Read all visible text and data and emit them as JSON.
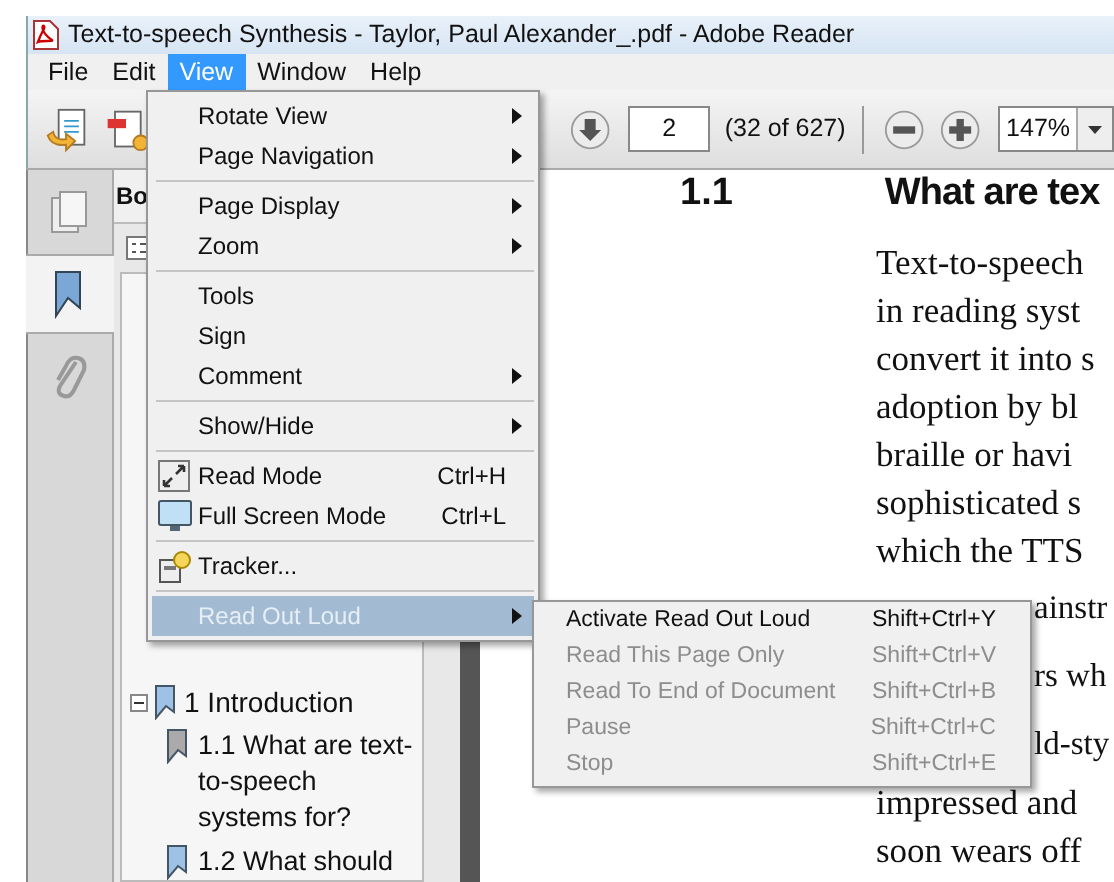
{
  "window": {
    "title": "Text-to-speech Synthesis - Taylor, Paul Alexander_.pdf - Adobe Reader"
  },
  "menu_bar": [
    {
      "label": "File",
      "selected": false
    },
    {
      "label": "Edit",
      "selected": false
    },
    {
      "label": "View",
      "selected": true
    },
    {
      "label": "Window",
      "selected": false
    },
    {
      "label": "Help",
      "selected": false
    }
  ],
  "toolbar": {
    "page_field": {
      "value": "2"
    },
    "page_count": "(32 of 627)",
    "zoom_field": {
      "value": "147%"
    }
  },
  "bookmarks": {
    "header": "Bo",
    "items": [
      {
        "label": "1 Introduction",
        "expanded": true,
        "children": [
          {
            "label": "1.1 What are text-to-speech systems for?"
          },
          {
            "label": "1.2 What should"
          }
        ]
      }
    ]
  },
  "document": {
    "section_number": "1.1",
    "heading": "What are tex",
    "lines": [
      {
        "text": "Text-to-speech",
        "covered": false
      },
      {
        "text": "in reading syst",
        "covered": false
      },
      {
        "text": "convert it into s",
        "covered": false
      },
      {
        "text": "adoption by bl",
        "covered": false
      },
      {
        "text": "braille or havi",
        "covered": false
      },
      {
        "text": "sophisticated s",
        "covered": false
      },
      {
        "text": "which the TTS",
        "covered": false
      },
      {
        "text": "ainstr",
        "covered": true
      },
      {
        "text": "rs wh",
        "covered": true
      },
      {
        "text": "ld-sty",
        "covered": true
      },
      {
        "text": "impressed and",
        "covered": false
      },
      {
        "text": "soon wears off",
        "covered": false
      }
    ]
  },
  "view_menu": [
    {
      "kind": "item",
      "label": "Rotate View",
      "submenu": true,
      "selected": false
    },
    {
      "kind": "item",
      "label": "Page Navigation",
      "submenu": true,
      "selected": false
    },
    {
      "kind": "separator"
    },
    {
      "kind": "item",
      "label": "Page Display",
      "submenu": true,
      "selected": false
    },
    {
      "kind": "item",
      "label": "Zoom",
      "submenu": true,
      "selected": false
    },
    {
      "kind": "separator"
    },
    {
      "kind": "item",
      "label": "Tools",
      "submenu": false,
      "selected": false
    },
    {
      "kind": "item",
      "label": "Sign",
      "submenu": false,
      "selected": false
    },
    {
      "kind": "item",
      "label": "Comment",
      "submenu": true,
      "selected": false
    },
    {
      "kind": "separator"
    },
    {
      "kind": "item",
      "label": "Show/Hide",
      "submenu": true,
      "selected": false
    },
    {
      "kind": "separator"
    },
    {
      "kind": "item",
      "label": "Read Mode",
      "shortcut": "Ctrl+H",
      "submenu": false,
      "selected": false
    },
    {
      "kind": "item",
      "label": "Full Screen Mode",
      "shortcut": "Ctrl+L",
      "submenu": false,
      "selected": false
    },
    {
      "kind": "separator"
    },
    {
      "kind": "item",
      "label": "Tracker...",
      "submenu": false,
      "selected": false
    },
    {
      "kind": "separator"
    },
    {
      "kind": "item",
      "label": "Read Out Loud",
      "submenu": true,
      "selected": true
    }
  ],
  "read_out_loud_menu": [
    {
      "label": "Activate Read Out Loud",
      "shortcut": "Shift+Ctrl+Y",
      "disabled": false
    },
    {
      "label": "Read This Page Only",
      "shortcut": "Shift+Ctrl+V",
      "disabled": true
    },
    {
      "label": "Read To End of Document",
      "shortcut": "Shift+Ctrl+B",
      "disabled": true
    },
    {
      "label": "Pause",
      "shortcut": "Shift+Ctrl+C",
      "disabled": true
    },
    {
      "label": "Stop",
      "shortcut": "Shift+Ctrl+E",
      "disabled": true
    }
  ]
}
